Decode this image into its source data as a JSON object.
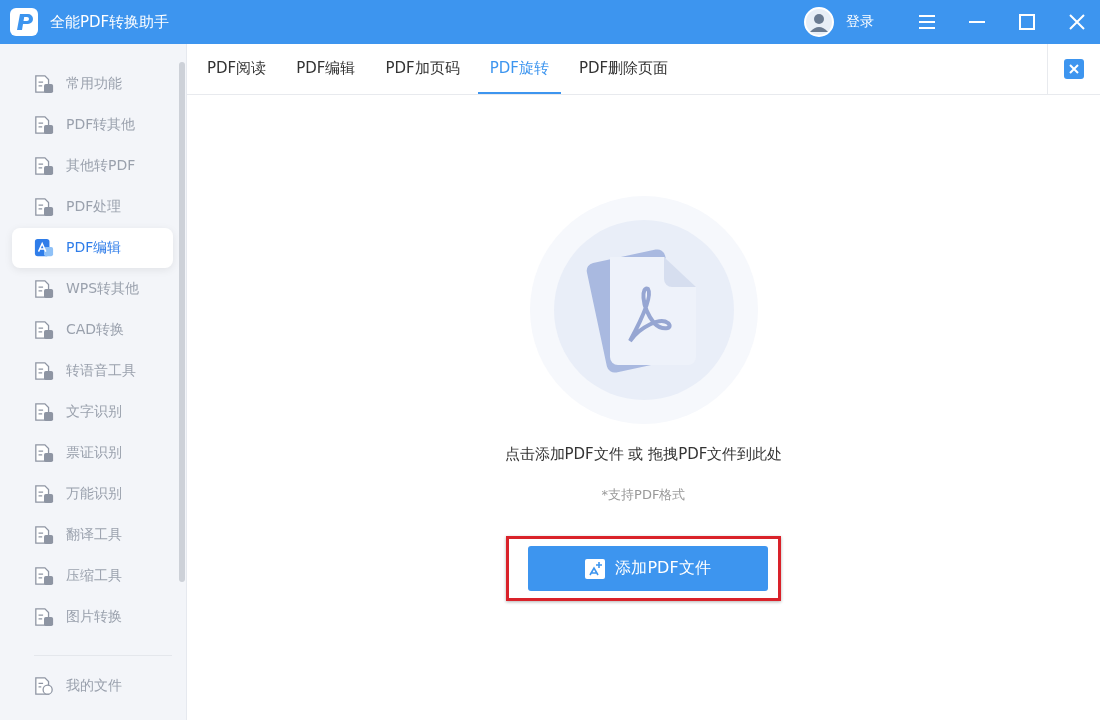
{
  "window": {
    "title": "全能PDF转换助手",
    "login": "登录"
  },
  "sidebar": {
    "items": [
      {
        "label": "常用功能",
        "selected": false
      },
      {
        "label": "PDF转其他",
        "selected": false
      },
      {
        "label": "其他转PDF",
        "selected": false
      },
      {
        "label": "PDF处理",
        "selected": false
      },
      {
        "label": "PDF编辑",
        "selected": true
      },
      {
        "label": "WPS转其他",
        "selected": false
      },
      {
        "label": "CAD转换",
        "selected": false
      },
      {
        "label": "转语音工具",
        "selected": false
      },
      {
        "label": "文字识别",
        "selected": false
      },
      {
        "label": "票证识别",
        "selected": false
      },
      {
        "label": "万能识别",
        "selected": false
      },
      {
        "label": "翻译工具",
        "selected": false
      },
      {
        "label": "压缩工具",
        "selected": false
      },
      {
        "label": "图片转换",
        "selected": false
      }
    ],
    "footer_item": {
      "label": "我的文件",
      "selected": false
    }
  },
  "tabs": [
    {
      "label": "PDF阅读",
      "selected": false
    },
    {
      "label": "PDF编辑",
      "selected": false
    },
    {
      "label": "PDF加页码",
      "selected": false
    },
    {
      "label": "PDF旋转",
      "selected": true
    },
    {
      "label": "PDF删除页面",
      "selected": false
    }
  ],
  "dropzone": {
    "instruction": "点击添加PDF文件 或 拖拽PDF文件到此处",
    "hint": "*支持PDF格式",
    "button": "添加PDF文件",
    "highlighted": true
  }
}
